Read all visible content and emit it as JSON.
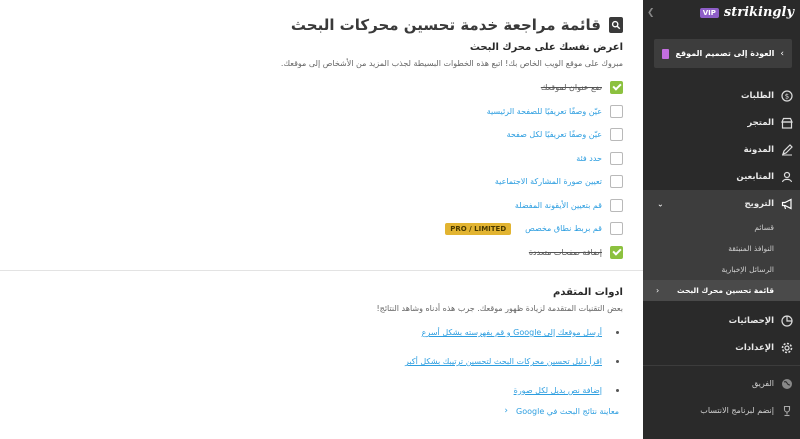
{
  "main": {
    "title": "قائمة مراجعة خدمة تحسين محركات البحث",
    "section_heading": "اعرض نفسك على محرك البحث",
    "section_description": "مبروك على موقع الويب الخاص بك! اتبع هذه الخطوات البسيطة لجذب المزيد من الأشخاص إلى موقعك.",
    "checklist": [
      {
        "label": "ضع عنوان لموقعك",
        "checked": true
      },
      {
        "label": "عيّن وصفًا تعريفيًا للصفحة الرئيسية",
        "checked": false
      },
      {
        "label": "عيّن وصفًا تعريفيًا لكل صفحة",
        "checked": false
      },
      {
        "label": "حدد فئة",
        "checked": false
      },
      {
        "label": "تعيين صورة المشاركة الاجتماعية",
        "checked": false
      },
      {
        "label": "قم بتعيين الأيقونة المفضلة",
        "checked": false
      },
      {
        "label": "قم بربط نطاق مخصص",
        "checked": false,
        "badge": "PRO / LIMITED"
      },
      {
        "label": "إضافة صفحات متعددة",
        "checked": true
      }
    ],
    "advanced_heading": "ادوات المتقدم",
    "advanced_description": "بعض التقنيات المتقدمة لزيادة ظهور موقعك. جرب هذه أدناه وشاهد النتائج!",
    "advanced_links": [
      "أرسل موقعك إلى Google و قم بفهرسته بشكل أسرع",
      "اقرأ دليل تحسين محركات البحث لتحسين ترتيبك بشكل أكبر",
      "إضافة نص بديل لكل صورة"
    ],
    "preview_link": "معاينة نتائج البحث في Google"
  },
  "sidebar": {
    "brand": "strikingly",
    "vip": "VIP",
    "back_label": "العودة إلى تصميم الموقع",
    "nav": [
      {
        "label": "الطلبات",
        "icon": "dollar-icon"
      },
      {
        "label": "المتجر",
        "icon": "store-icon"
      },
      {
        "label": "المدونة",
        "icon": "pen-icon"
      },
      {
        "label": "المتابعين",
        "icon": "users-icon"
      },
      {
        "label": "الترويج",
        "icon": "megaphone-icon"
      }
    ],
    "sub_items": [
      "قسائم",
      "النوافذ المنبثقة",
      "الرسائل الإخبارية",
      "قائمة تحسين محرك البحث"
    ],
    "nav_bottom": [
      {
        "label": "الإحصائيات",
        "icon": "chart-icon"
      },
      {
        "label": "الإعدادات",
        "icon": "gear-icon"
      }
    ],
    "team_label": "الفريق",
    "affiliate_label": "إنضم لبرنامج الانتساب"
  },
  "colors": {
    "link": "#2d9ee0",
    "check": "#8cc13f",
    "badge": "#e2b431",
    "sidebar": "#2a2a2a",
    "vip": "#8e5ec7"
  }
}
